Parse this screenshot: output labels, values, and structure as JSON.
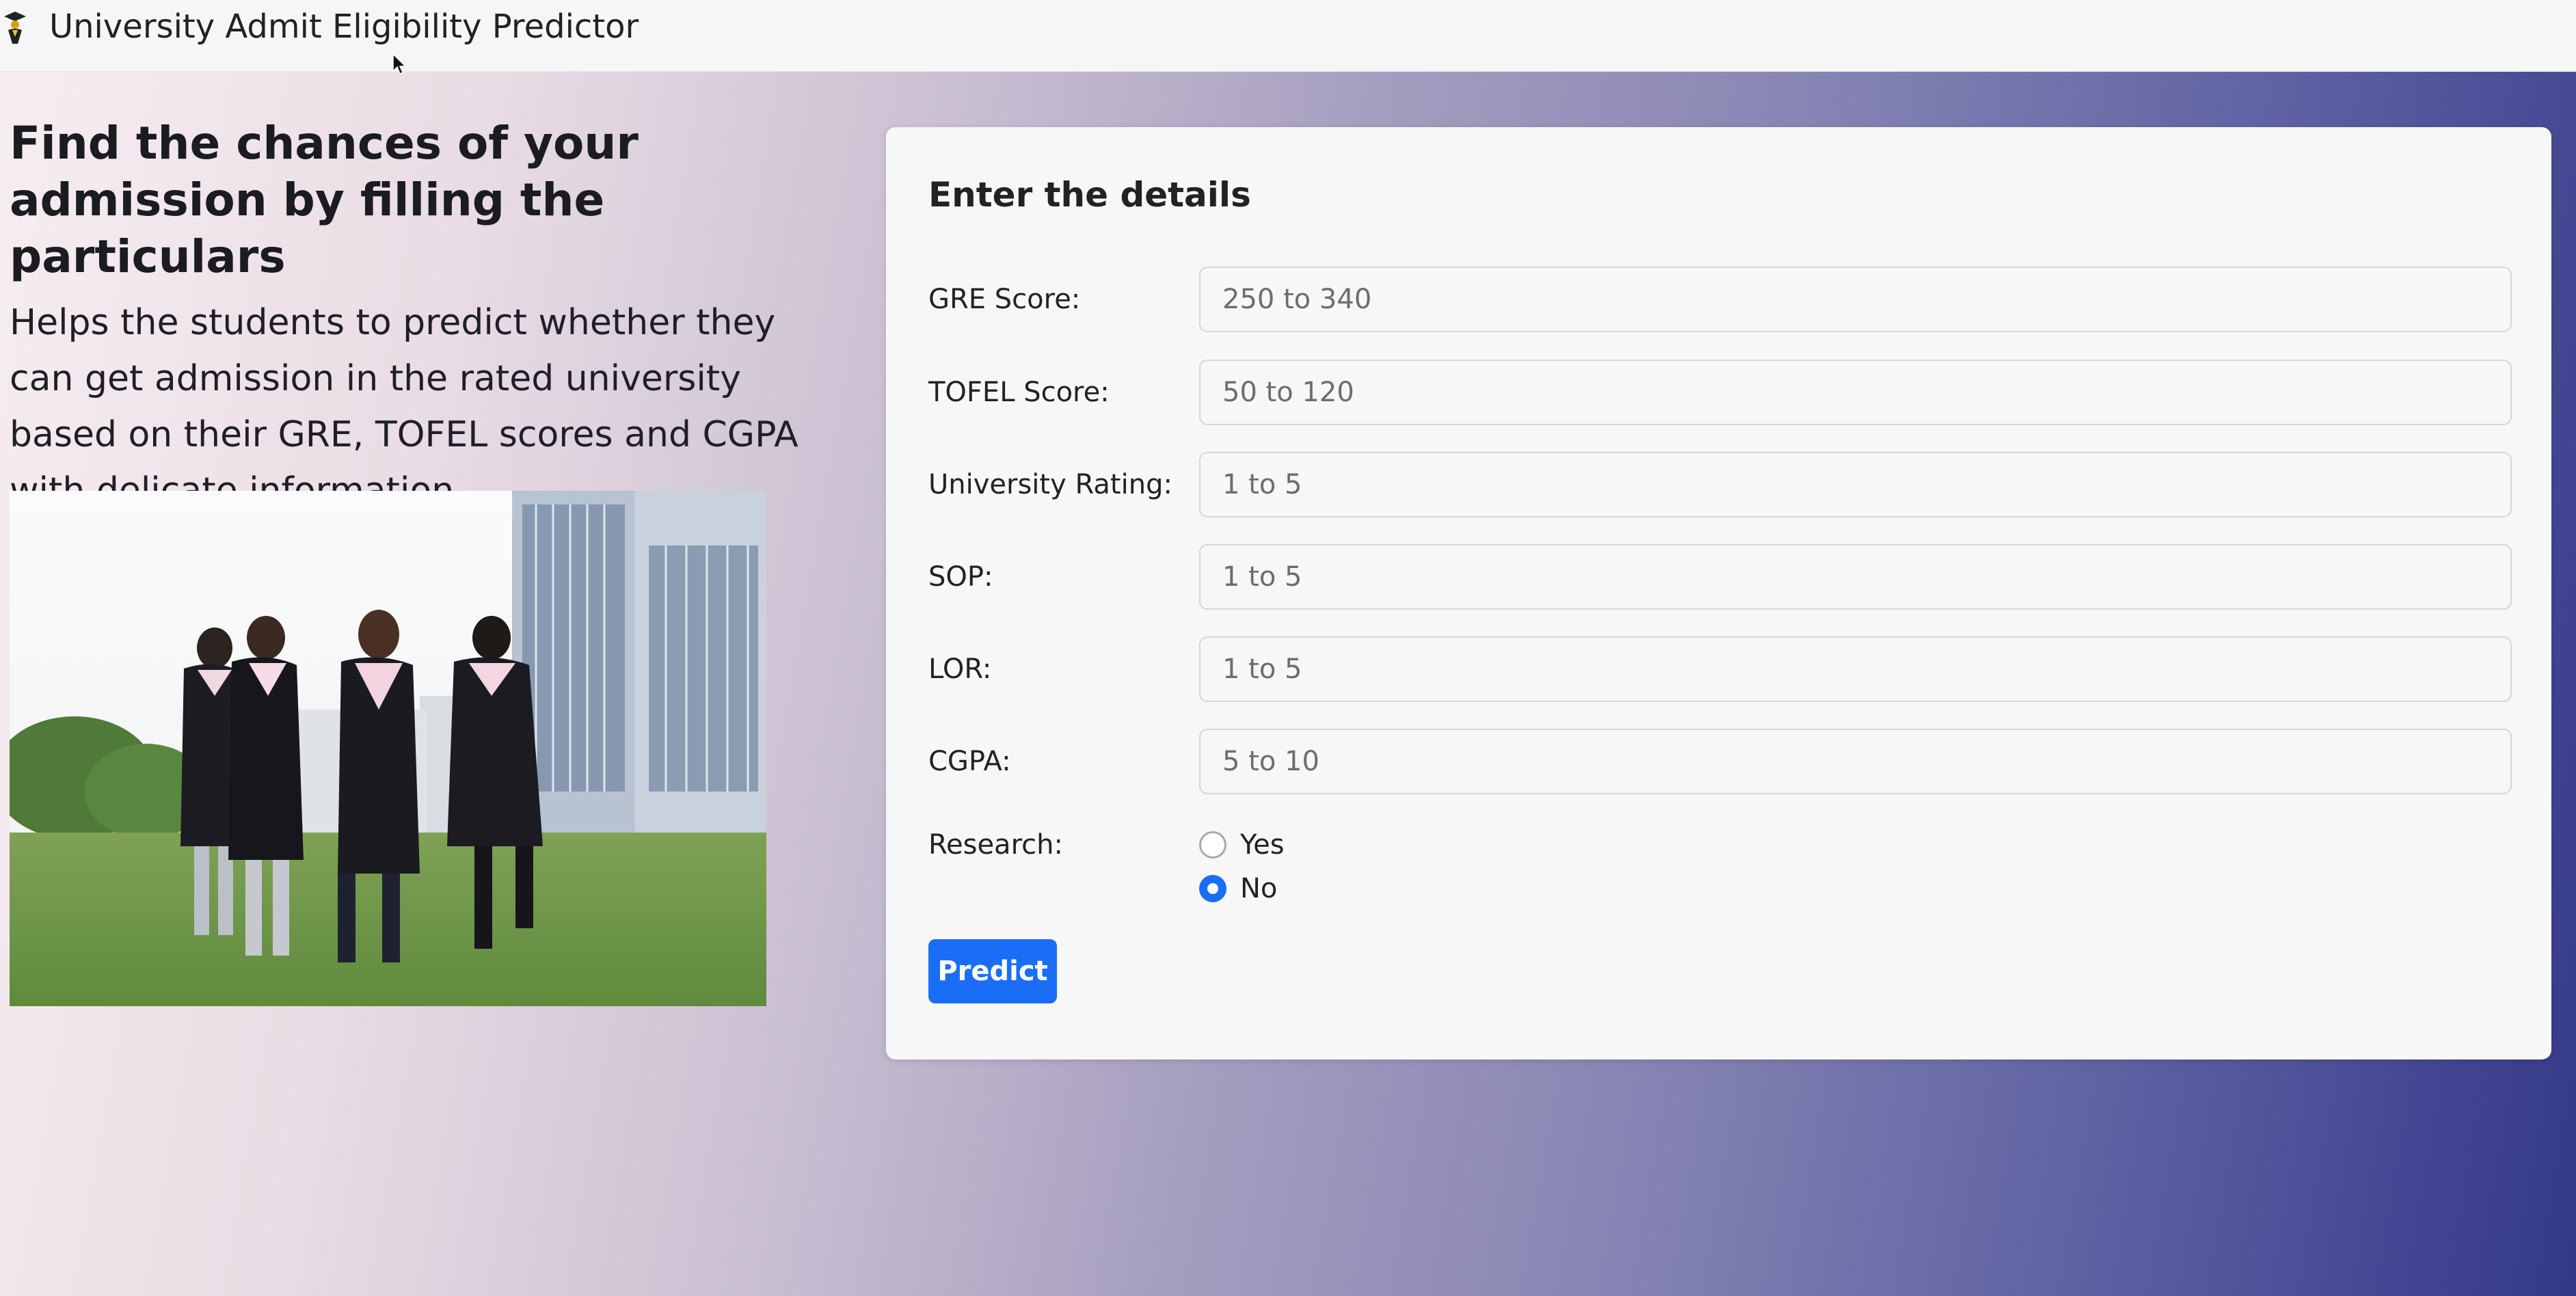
{
  "header": {
    "title": "University Admit Eligibility Predictor",
    "logo_icon": "graduate-person-icon"
  },
  "hero": {
    "headline": "Find the chances of your admission by filling the particulars",
    "description": "Helps the students to predict whether they can get admission in the rated university based on their GRE, TOFEL scores and CGPA with delicate information.",
    "image_subject": "students in graduation gowns on a lawn"
  },
  "form": {
    "title": "Enter the details",
    "fields": [
      {
        "label": "GRE Score:",
        "placeholder": "250 to 340",
        "value": ""
      },
      {
        "label": "TOFEL Score:",
        "placeholder": "50 to 120",
        "value": ""
      },
      {
        "label": "University Rating:",
        "placeholder": "1 to 5",
        "value": ""
      },
      {
        "label": "SOP:",
        "placeholder": "1 to 5",
        "value": ""
      },
      {
        "label": "LOR:",
        "placeholder": "1 to 5",
        "value": ""
      },
      {
        "label": "CGPA:",
        "placeholder": "5 to 10",
        "value": ""
      }
    ],
    "research": {
      "label": "Research:",
      "options": [
        "Yes",
        "No"
      ],
      "selected": "No"
    },
    "submit_label": "Predict"
  },
  "colors": {
    "primary": "#1a6ef5",
    "navbar": "#f6f6f6",
    "card": "#f7f7f7",
    "gradient_start": "#f7eef1",
    "gradient_end": "#34388a"
  }
}
